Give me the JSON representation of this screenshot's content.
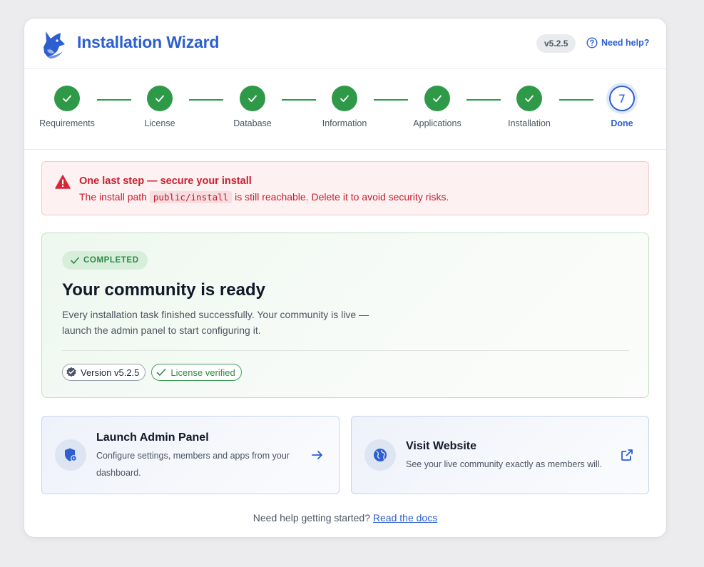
{
  "app": {
    "title": "Installation Wizard",
    "version": "v5.2.5",
    "help_label": "Need help?",
    "logo_icon": "fox-logo-icon"
  },
  "colors": {
    "accent": "#2d5fd0",
    "success": "#2e9a48",
    "danger": "#c81e2e"
  },
  "steps": [
    {
      "label": "Requirements",
      "state": "complete"
    },
    {
      "label": "License",
      "state": "complete"
    },
    {
      "label": "Database",
      "state": "complete"
    },
    {
      "label": "Information",
      "state": "complete"
    },
    {
      "label": "Applications",
      "state": "complete"
    },
    {
      "label": "Installation",
      "state": "complete"
    },
    {
      "label": "Done",
      "number": "7",
      "state": "current"
    }
  ],
  "alert": {
    "title": "One last step — secure your install",
    "body_before": "The install path ",
    "path": "public/install",
    "body_after": " is still reachable. Delete it to avoid security risks."
  },
  "success": {
    "badge": "COMPLETED",
    "title": "Your community is ready",
    "description": "Every installation task finished successfully. Your community is live — launch the admin panel to start configuring it.",
    "chips": {
      "version": "Version v5.2.5",
      "license": "License verified"
    }
  },
  "actions": {
    "admin": {
      "title": "Launch Admin Panel",
      "description": "Configure settings, members and apps from your dashboard."
    },
    "website": {
      "title": "Visit Website",
      "description": "See your live community exactly as members will."
    }
  },
  "footer": {
    "text": "Need help getting started? ",
    "link": "Read the docs"
  }
}
